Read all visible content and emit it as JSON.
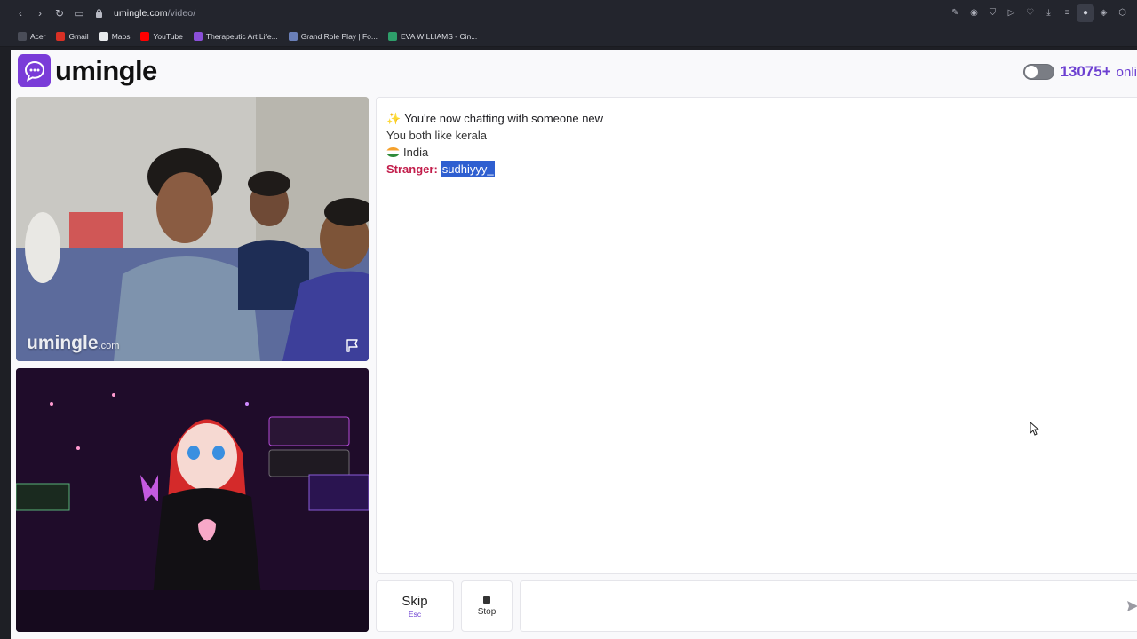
{
  "browser": {
    "url_host": "umingle.com",
    "url_path": "/video/",
    "bookmarks": [
      {
        "label": "Acer",
        "color": "#4a4d58"
      },
      {
        "label": "Gmail",
        "color": "#d93025"
      },
      {
        "label": "Maps",
        "color": "#e8eaed"
      },
      {
        "label": "YouTube",
        "color": "#ff0000"
      },
      {
        "label": "Therapeutic Art Life...",
        "color": "#8a4fd8"
      },
      {
        "label": "Grand Role Play | Fo...",
        "color": "#6a7fb8"
      },
      {
        "label": "EVA WILLIAMS - Cin...",
        "color": "#2e9e6a"
      }
    ]
  },
  "header": {
    "brand": "umingle",
    "online_count": "13075+",
    "online_label": "onli"
  },
  "video": {
    "watermark": "umingle",
    "watermark_suffix": ".com"
  },
  "chat": {
    "intro": "You're now chatting with someone new",
    "interest": "You both like kerala",
    "country": "India",
    "stranger_label": "Stranger:",
    "stranger_message": "sudhiyyy_"
  },
  "controls": {
    "skip_label": "Skip",
    "skip_key": "Esc",
    "stop_label": "Stop",
    "message_placeholder": ""
  },
  "colors": {
    "accent": "#6c3fd1",
    "stranger": "#c21d4b",
    "selection": "#2f5fd0"
  }
}
